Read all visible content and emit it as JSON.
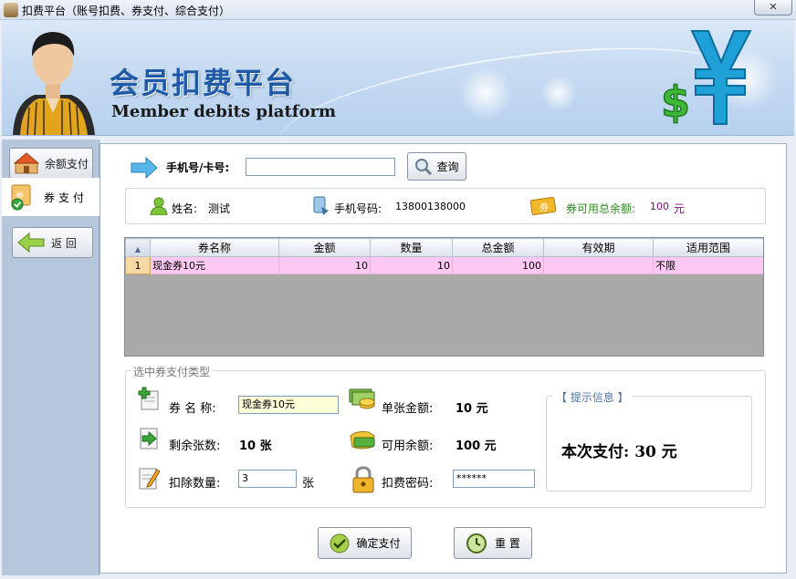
{
  "window": {
    "title": "扣费平台（账号扣费、券支付、综合支付）",
    "close_label": "✕"
  },
  "banner": {
    "title_cn": "会员扣费平台",
    "title_en": "Member debits platform"
  },
  "nav": {
    "balance_label": "余额支付",
    "coupon_label": "券支付",
    "back_label": "返 回"
  },
  "search": {
    "label": "手机号/卡号:",
    "value": "",
    "button": "查询"
  },
  "member": {
    "name_label": "姓名:",
    "name": "测试",
    "phone_label": "手机号码:",
    "phone": "13800138000",
    "total_label": "券可用总余额:",
    "total_value": "100",
    "total_unit": "元"
  },
  "grid": {
    "columns": [
      "券名称",
      "金额",
      "数量",
      "总金额",
      "有效期",
      "适用范围"
    ],
    "rows": [
      {
        "index": "1",
        "name": "现金券10元",
        "amount": "10",
        "qty": "10",
        "total": "100",
        "expiry": "",
        "scope": "不限"
      }
    ]
  },
  "form": {
    "legend": "选中券支付类型",
    "coupon_name_label": "券 名 称:",
    "coupon_name_value": "现金券10元",
    "remaining_label": "剩余张数:",
    "remaining_value": "10 张",
    "deduct_label": "扣除数量:",
    "deduct_value": "3",
    "deduct_unit": "张",
    "unit_amount_label": "单张金额:",
    "unit_amount_value": "10 元",
    "available_label": "可用余额:",
    "available_value": "100 元",
    "password_label": "扣费密码:",
    "password_value": "******"
  },
  "tip": {
    "legend": "【 提示信息 】",
    "message": "本次支付: 30 元"
  },
  "actions": {
    "confirm": "确定支付",
    "reset": "重 置"
  },
  "colors": {
    "banner_title": "#1f5aa6",
    "row_highlight": "#ffc8f2",
    "nav_panel": "#b6c7dc"
  }
}
